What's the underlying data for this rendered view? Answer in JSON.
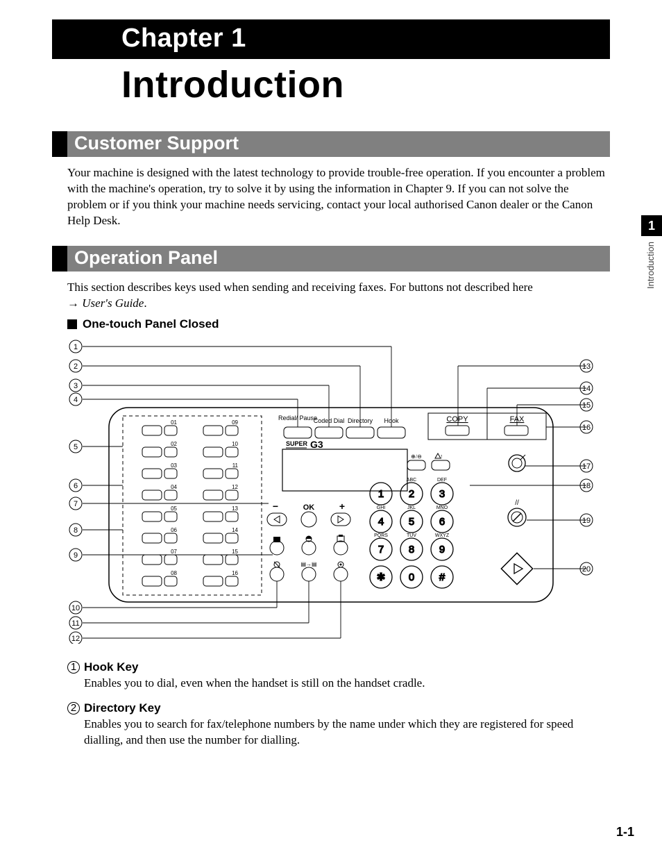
{
  "chapter_label": "Chapter 1",
  "chapter_title": "Introduction",
  "side_tab": {
    "number": "1",
    "label": "Introduction"
  },
  "page_number": "1-1",
  "sections": {
    "customer_support": {
      "heading": "Customer Support",
      "body": "Your machine is designed with the latest technology to provide trouble-free operation. If you encounter a problem with the machine's operation, try to solve it by using the information in Chapter 9. If you can not solve the problem or if you think your machine needs servicing, contact your local authorised Canon dealer or the Canon Help Desk."
    },
    "operation_panel": {
      "heading": "Operation Panel",
      "intro_line1": "This section describes keys used when sending and receiving faxes. For buttons not described here",
      "intro_arrow": "→ ",
      "intro_guide": "User's Guide",
      "intro_period": ".",
      "subheading": "One-touch Panel Closed"
    }
  },
  "diagram": {
    "callouts_left": [
      "1",
      "2",
      "3",
      "4",
      "5",
      "6",
      "7",
      "8",
      "9",
      "10",
      "11",
      "12"
    ],
    "callouts_right": [
      "13",
      "14",
      "15",
      "16",
      "17",
      "18",
      "19",
      "20"
    ],
    "top_buttons": [
      "Redial/\nPause",
      "Coded Dial",
      "Directory",
      "Hook"
    ],
    "mode_buttons": {
      "copy": "COPY",
      "fax": "FAX"
    },
    "logo": "SUPER",
    "logo_g3": "G3",
    "ok_label": "OK",
    "keypad_letters": {
      "r1": [
        "",
        "ABC",
        "DEF"
      ],
      "r2": [
        "GHI",
        "JKL",
        "MNO"
      ],
      "r3": [
        "PQRS",
        "TUV",
        "WXYZ"
      ]
    },
    "keypad": [
      [
        "1",
        "2",
        "3"
      ],
      [
        "4",
        "5",
        "6"
      ],
      [
        "7",
        "8",
        "9"
      ],
      [
        "✱",
        "0",
        "#"
      ]
    ],
    "one_touch_numbers": [
      "01",
      "02",
      "03",
      "04",
      "05",
      "06",
      "07",
      "08",
      "09",
      "10",
      "11",
      "12",
      "13",
      "14",
      "15",
      "16"
    ],
    "misc_symbols": {
      "minus": "−",
      "plus": "+",
      "slash": "//"
    }
  },
  "keys": {
    "1": {
      "num": "1",
      "title": "Hook  Key",
      "desc": "Enables you to dial, even when the handset is still on the handset cradle."
    },
    "2": {
      "num": "2",
      "title": "Directory Key",
      "desc": "Enables you to search for fax/telephone numbers by the name under which they are registered for speed dialling, and then use the number for dialling."
    }
  }
}
